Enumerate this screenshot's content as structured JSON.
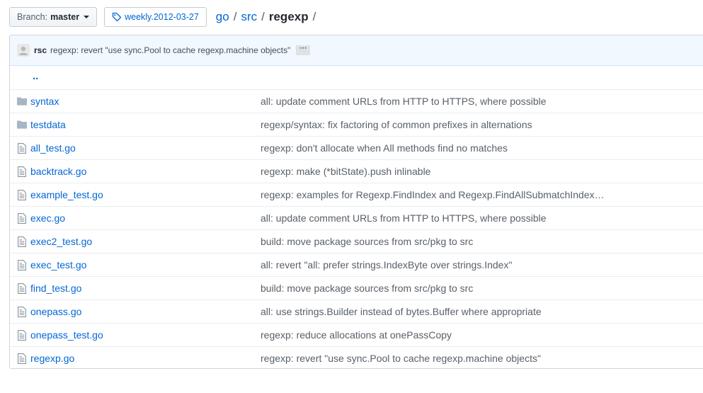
{
  "branch": {
    "label": "Branch:",
    "value": "master"
  },
  "tag": {
    "label": "weekly.2012-03-27"
  },
  "breadcrumb": {
    "root": "go",
    "sep1": "/",
    "dir1": "src",
    "sep2": "/",
    "current": "regexp",
    "sep3": "/"
  },
  "commit": {
    "author": "rsc",
    "message": "regexp: revert \"use sync.Pool to cache regexp.machine objects\"",
    "more": "···"
  },
  "parent_dir": "..",
  "files": [
    {
      "name": "syntax",
      "type": "folder",
      "message": "all: update comment URLs from HTTP to HTTPS, where possible"
    },
    {
      "name": "testdata",
      "type": "folder",
      "message": "regexp/syntax: fix factoring of common prefixes in alternations"
    },
    {
      "name": "all_test.go",
      "type": "file",
      "message": "regexp: don't allocate when All methods find no matches"
    },
    {
      "name": "backtrack.go",
      "type": "file",
      "message": "regexp: make (*bitState).push inlinable"
    },
    {
      "name": "example_test.go",
      "type": "file",
      "message": "regexp: examples for Regexp.FindIndex and Regexp.FindAllSubmatchIndex…"
    },
    {
      "name": "exec.go",
      "type": "file",
      "message": "all: update comment URLs from HTTP to HTTPS, where possible"
    },
    {
      "name": "exec2_test.go",
      "type": "file",
      "message": "build: move package sources from src/pkg to src"
    },
    {
      "name": "exec_test.go",
      "type": "file",
      "message": "all: revert \"all: prefer strings.IndexByte over strings.Index\""
    },
    {
      "name": "find_test.go",
      "type": "file",
      "message": "build: move package sources from src/pkg to src"
    },
    {
      "name": "onepass.go",
      "type": "file",
      "message": "all: use strings.Builder instead of bytes.Buffer where appropriate"
    },
    {
      "name": "onepass_test.go",
      "type": "file",
      "message": "regexp: reduce allocations at onePassCopy"
    },
    {
      "name": "regexp.go",
      "type": "file",
      "message": "regexp: revert \"use sync.Pool to cache regexp.machine objects\""
    }
  ],
  "colors": {
    "link": "#0366d6",
    "commit_bg": "#f1f8ff",
    "folder": "#79b8ff"
  }
}
